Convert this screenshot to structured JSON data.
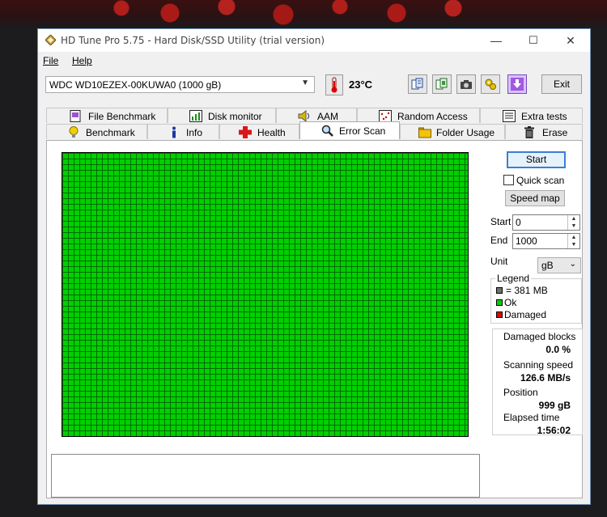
{
  "window": {
    "title": "HD Tune Pro 5.75 - Hard Disk/SSD Utility (trial version)",
    "minimize": "—",
    "maximize": "☐",
    "close": "✕"
  },
  "menu": {
    "file": "File",
    "help": "Help"
  },
  "toolbar": {
    "drive": "WDC WD10EZEX-00KUWA0 (1000 gB)",
    "temperature": "23°C",
    "exit_label": "Exit",
    "buttons": [
      "copy-info-icon",
      "copy-screen-icon",
      "screenshot-camera-icon",
      "options-tools-icon",
      "save-download-icon"
    ]
  },
  "tabs": {
    "row1": [
      "File Benchmark",
      "Disk monitor",
      "AAM",
      "Random Access",
      "Extra tests"
    ],
    "row2": [
      "Benchmark",
      "Info",
      "Health",
      "Error Scan",
      "Folder Usage",
      "Erase"
    ],
    "active": "Error Scan"
  },
  "error_scan": {
    "start_label": "Start",
    "quick_scan_label": "Quick scan",
    "quick_scan_checked": false,
    "speed_map_label": "Speed map",
    "start_field_label": "Start",
    "start_value": "0",
    "end_field_label": "End",
    "end_value": "1000",
    "unit_label": "Unit",
    "unit_value": "gB",
    "legend": {
      "title": "Legend",
      "block_size": "= 381 MB",
      "ok": "Ok",
      "damaged": "Damaged"
    },
    "stats": {
      "damaged_blocks_label": "Damaged blocks",
      "damaged_blocks_value": "0.0 %",
      "scanning_speed_label": "Scanning speed",
      "scanning_speed_value": "126.6 MB/s",
      "position_label": "Position",
      "position_value": "999 gB",
      "elapsed_label": "Elapsed time",
      "elapsed_value": "1:56:02"
    },
    "block_status": "all ok"
  },
  "colors": {
    "ok": "#00d000",
    "damaged": "#e00000",
    "block_size_swatch": "#707070",
    "accent": "#3c7fd0"
  }
}
